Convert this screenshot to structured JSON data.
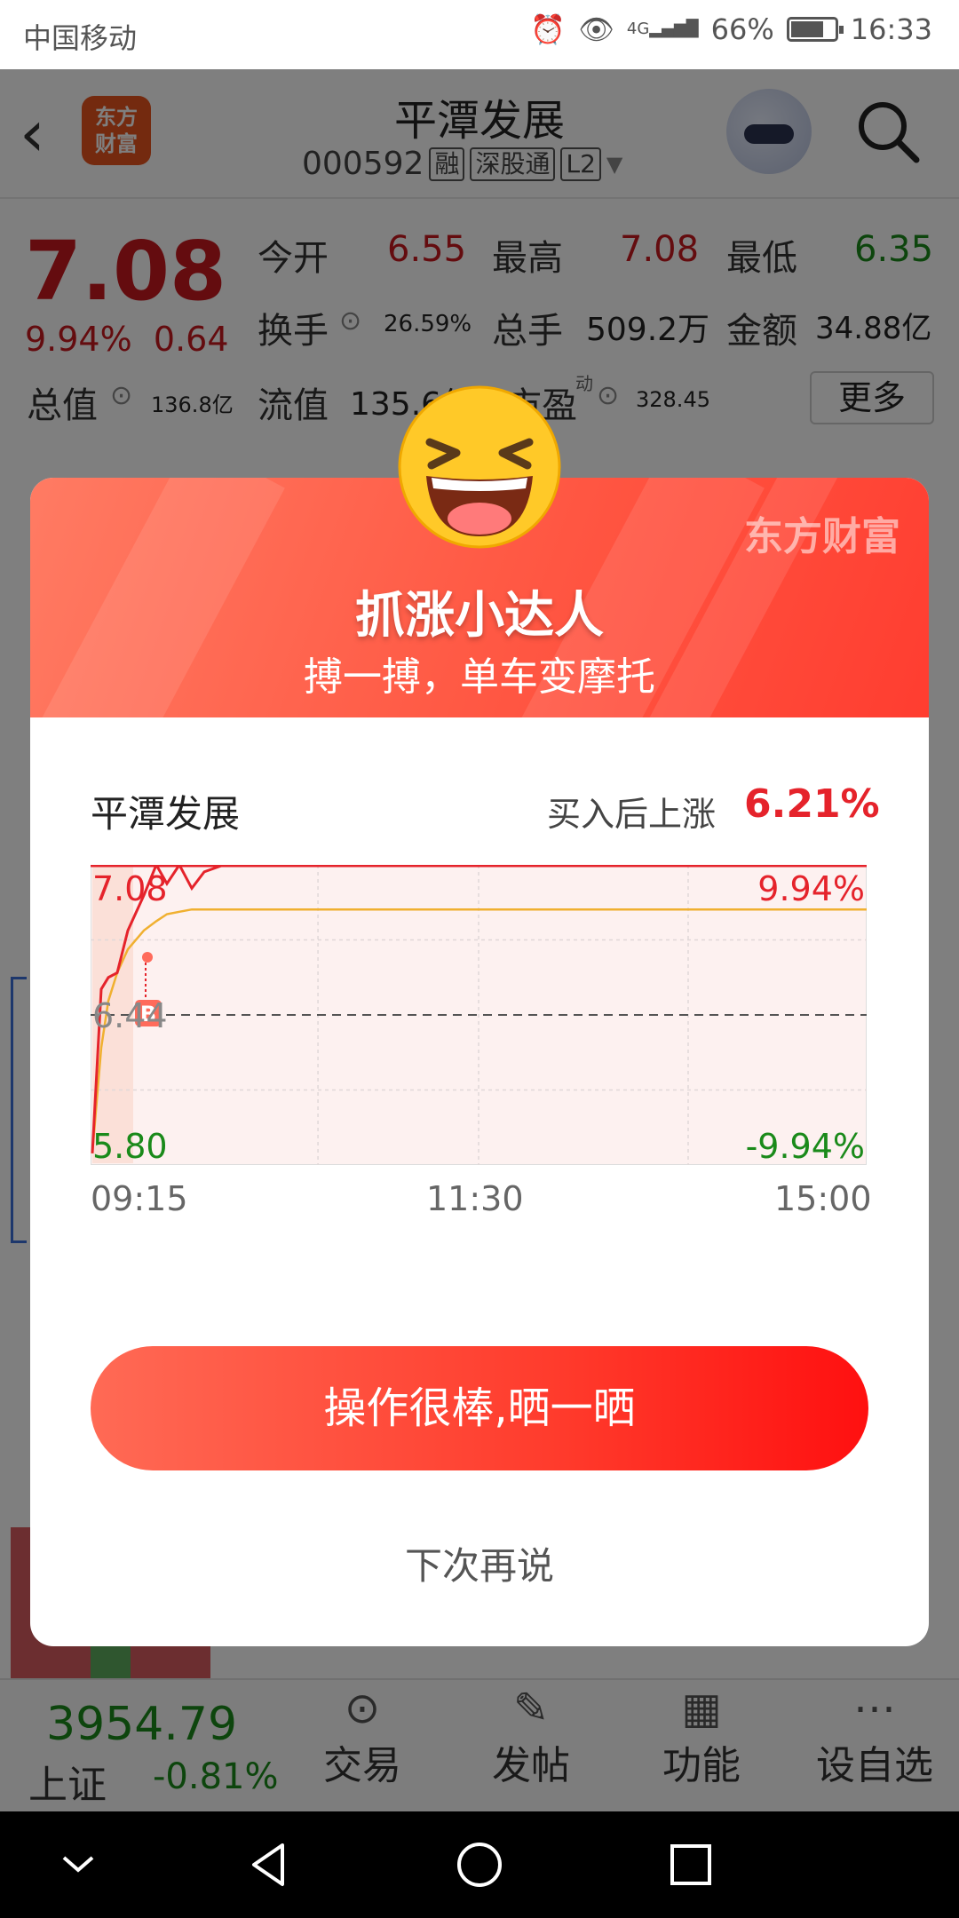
{
  "status": {
    "carrier": "中国移动",
    "network": "4G",
    "battery": "66%",
    "time": "16:33"
  },
  "header": {
    "logo_line1": "东方",
    "logo_line2": "财富",
    "stock_name": "平潭发展",
    "stock_code": "000592",
    "tags": [
      "融",
      "深股通",
      "L2"
    ]
  },
  "quote": {
    "price": "7.08",
    "change_pct": "9.94%",
    "change_amt": "0.64",
    "open_label": "今开",
    "open": "6.55",
    "high_label": "最高",
    "high": "7.08",
    "low_label": "最低",
    "low": "6.35",
    "turnover_label": "换手",
    "turnover": "26.59%",
    "volume_label": "总手",
    "volume": "509.2万",
    "amount_label": "金额",
    "amount": "34.88亿",
    "mktcap_label": "总值",
    "mktcap": "136.8亿",
    "float_label": "流值",
    "float": "135.6亿",
    "pe_label": "市盈",
    "pe_sup": "动",
    "pe": "328.45",
    "more_label": "更多"
  },
  "bottom_bar": {
    "index_value": "3954.79",
    "index_name": "上证",
    "index_change": "-0.81%",
    "items": [
      "交易",
      "发帖",
      "功能",
      "设自选"
    ]
  },
  "dialog": {
    "brand": "东方财富",
    "title": "抓涨小达人",
    "subtitle": "搏一搏，单车变摩托",
    "stock_name": "平潭发展",
    "gain_label": "买入后上涨",
    "gain_value": "6.21%",
    "buy_marker": "B",
    "share_button": "操作很棒,晒一晒",
    "later_button": "下次再说"
  },
  "chart_data": {
    "type": "line",
    "x_labels": [
      "09:15",
      "11:30",
      "15:00"
    ],
    "y_left_labels": [
      "7.08",
      "6.44",
      "5.80"
    ],
    "y_right_labels": [
      "9.94%",
      "-9.94%"
    ],
    "ylim": [
      5.8,
      7.08
    ],
    "prev_close": 6.44,
    "series": [
      {
        "values": [
          5.85,
          6.55,
          6.6,
          6.62,
          6.8,
          6.95,
          7.08,
          7.0,
          7.08,
          6.98,
          7.05,
          7.08,
          7.08,
          7.08
        ]
      },
      {
        "values": [
          5.85,
          6.3,
          6.5,
          6.62,
          6.72,
          6.8,
          6.84,
          6.87,
          6.88,
          6.89,
          6.89,
          6.89,
          6.89,
          6.89
        ]
      }
    ],
    "colors": {
      "price": "#e5232b",
      "avg": "#f0b030",
      "grid": "#e0d8d8",
      "fill": "#fdf1f0"
    }
  }
}
